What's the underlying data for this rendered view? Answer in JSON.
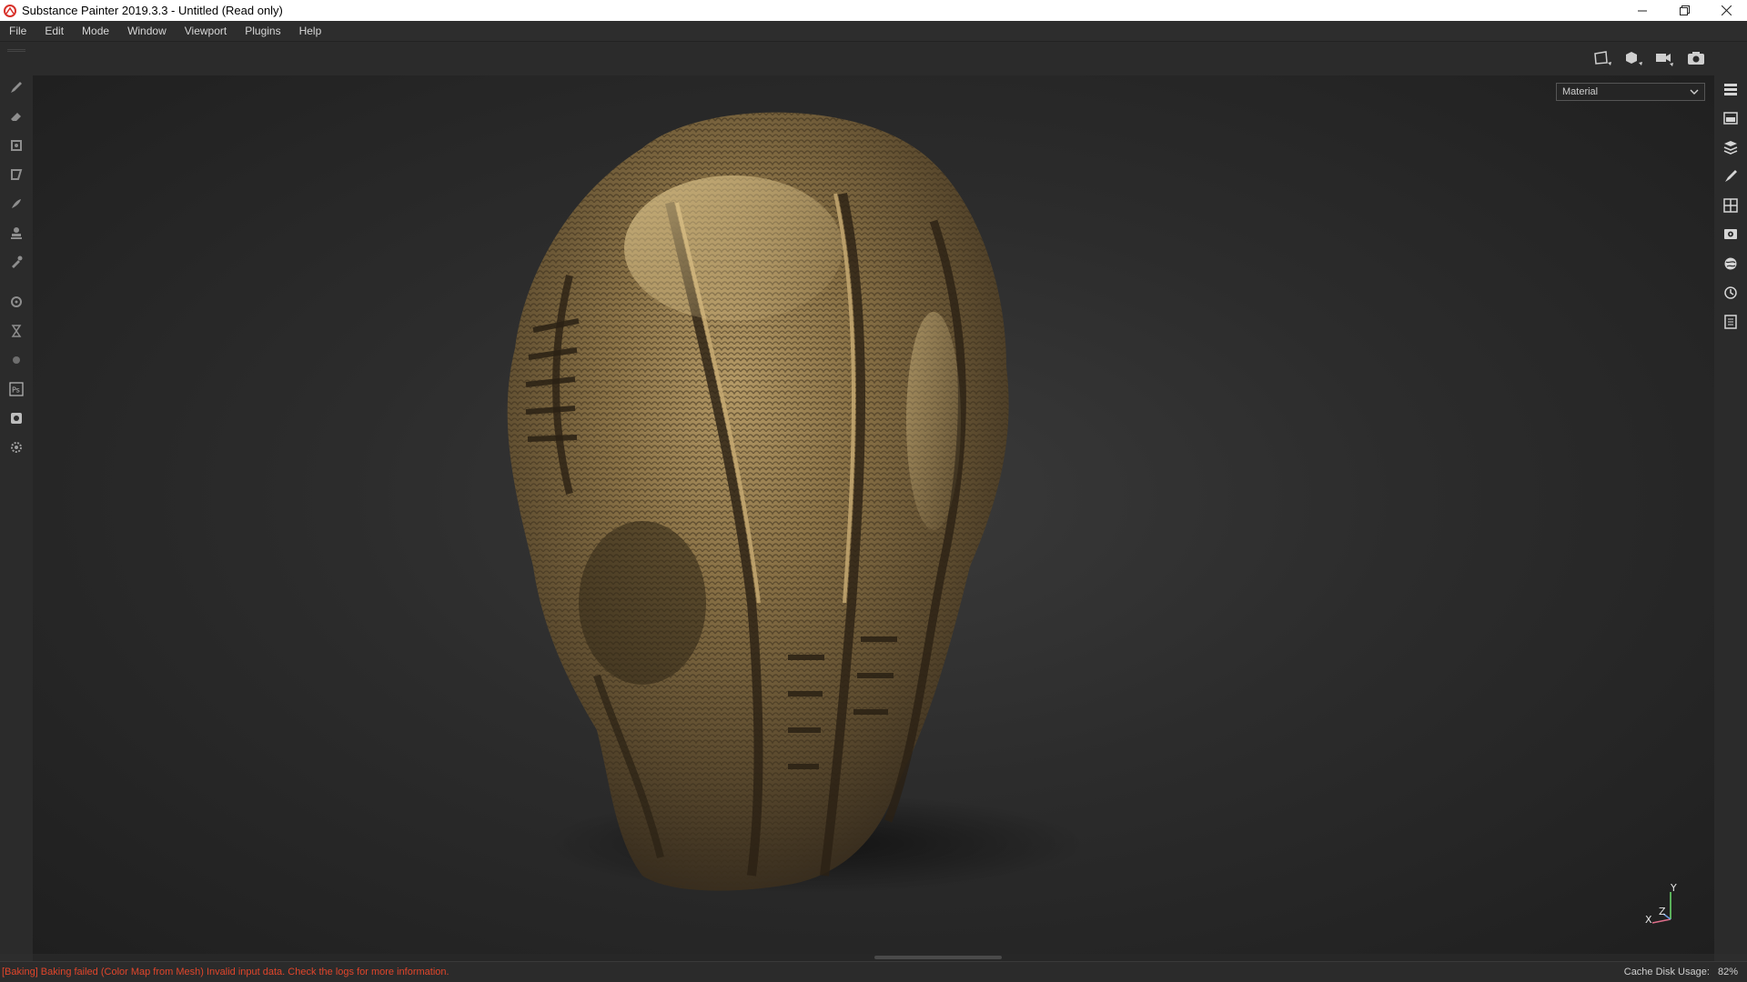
{
  "window": {
    "title": "Substance Painter 2019.3.3 - Untitled (Read only)",
    "controls": [
      "minimize-icon",
      "restore-icon",
      "close-icon"
    ]
  },
  "menu": {
    "items": [
      "File",
      "Edit",
      "Mode",
      "Window",
      "Viewport",
      "Plugins",
      "Help"
    ]
  },
  "toolbar_left": {
    "tools": [
      "paint-brush-icon",
      "eraser-icon",
      "projection-icon",
      "polygon-fill-icon",
      "smudge-icon",
      "clone-stamp-icon",
      "color-picker-icon",
      "bake-icon",
      "geometry-mask-icon",
      "material-icon",
      "photoshop-export-icon",
      "export-textures-icon",
      "settings-icon"
    ]
  },
  "toolbar_top": {
    "view_icons": [
      "frame-icon",
      "3d-view-icon",
      "camera-icon",
      "screenshot-icon"
    ]
  },
  "toolbar_right": {
    "panels": [
      "layers-stack-icon",
      "shelf-icon",
      "texture-set-icon",
      "brush-properties-icon",
      "uv-grid-icon",
      "display-settings-icon",
      "environment-icon",
      "history-icon",
      "log-icon"
    ]
  },
  "viewport": {
    "channel_select": "Material",
    "axis": {
      "y": "Y",
      "z": "Z",
      "x": "X"
    },
    "model": "sculpted-bronze-head",
    "material_color": "#8a7246"
  },
  "status": {
    "log": "[Baking] Baking failed (Color Map from Mesh) Invalid input data. Check the logs for more information.",
    "cache_label": "Cache Disk Usage:",
    "cache_value": "82%",
    "error_color": "#e0452b"
  }
}
